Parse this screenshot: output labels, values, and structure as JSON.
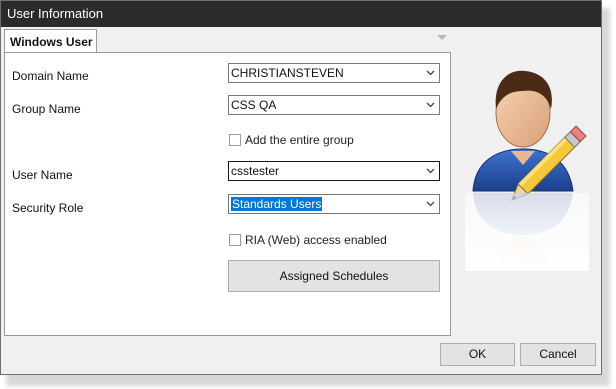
{
  "window": {
    "title": "User Information"
  },
  "tabs": [
    {
      "label": "Windows User"
    }
  ],
  "form": {
    "domain": {
      "label": "Domain Name",
      "value": "CHRISTIANSTEVEN"
    },
    "group": {
      "label": "Group Name",
      "value": "CSS QA"
    },
    "entire_group": {
      "label": "Add the entire group",
      "checked": false
    },
    "username": {
      "label": "User Name",
      "value": "csstester"
    },
    "security_role": {
      "label": "Security Role",
      "value": "Standards Users"
    },
    "ria_access": {
      "label": "RIA (Web) access enabled",
      "checked": false
    },
    "assigned_schedules_label": "Assigned Schedules"
  },
  "footer": {
    "ok_label": "OK",
    "cancel_label": "Cancel"
  },
  "icons": {
    "user": "user-edit-icon",
    "dropdown": "chevron-down-icon"
  },
  "colors": {
    "titlebar": "#2b2b2b",
    "selection": "#0078d7",
    "shirt": "#1f4fa8"
  }
}
